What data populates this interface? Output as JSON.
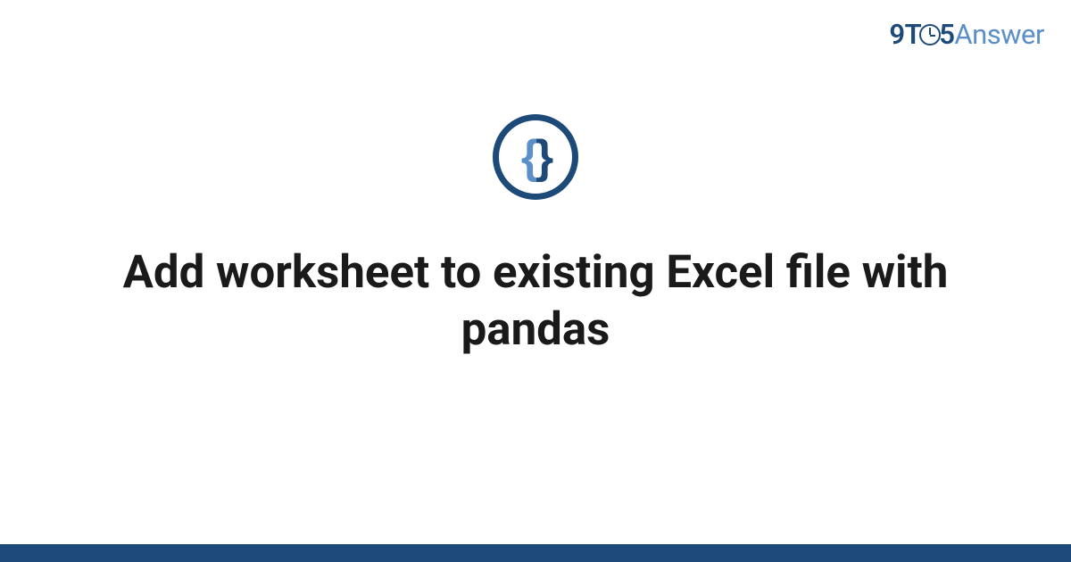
{
  "logo": {
    "nine": "9",
    "t": "T",
    "five": "5",
    "answer": "Answer"
  },
  "icon": {
    "brace_left": "{",
    "brace_right": "}"
  },
  "title": "Add worksheet to existing Excel file with pandas"
}
